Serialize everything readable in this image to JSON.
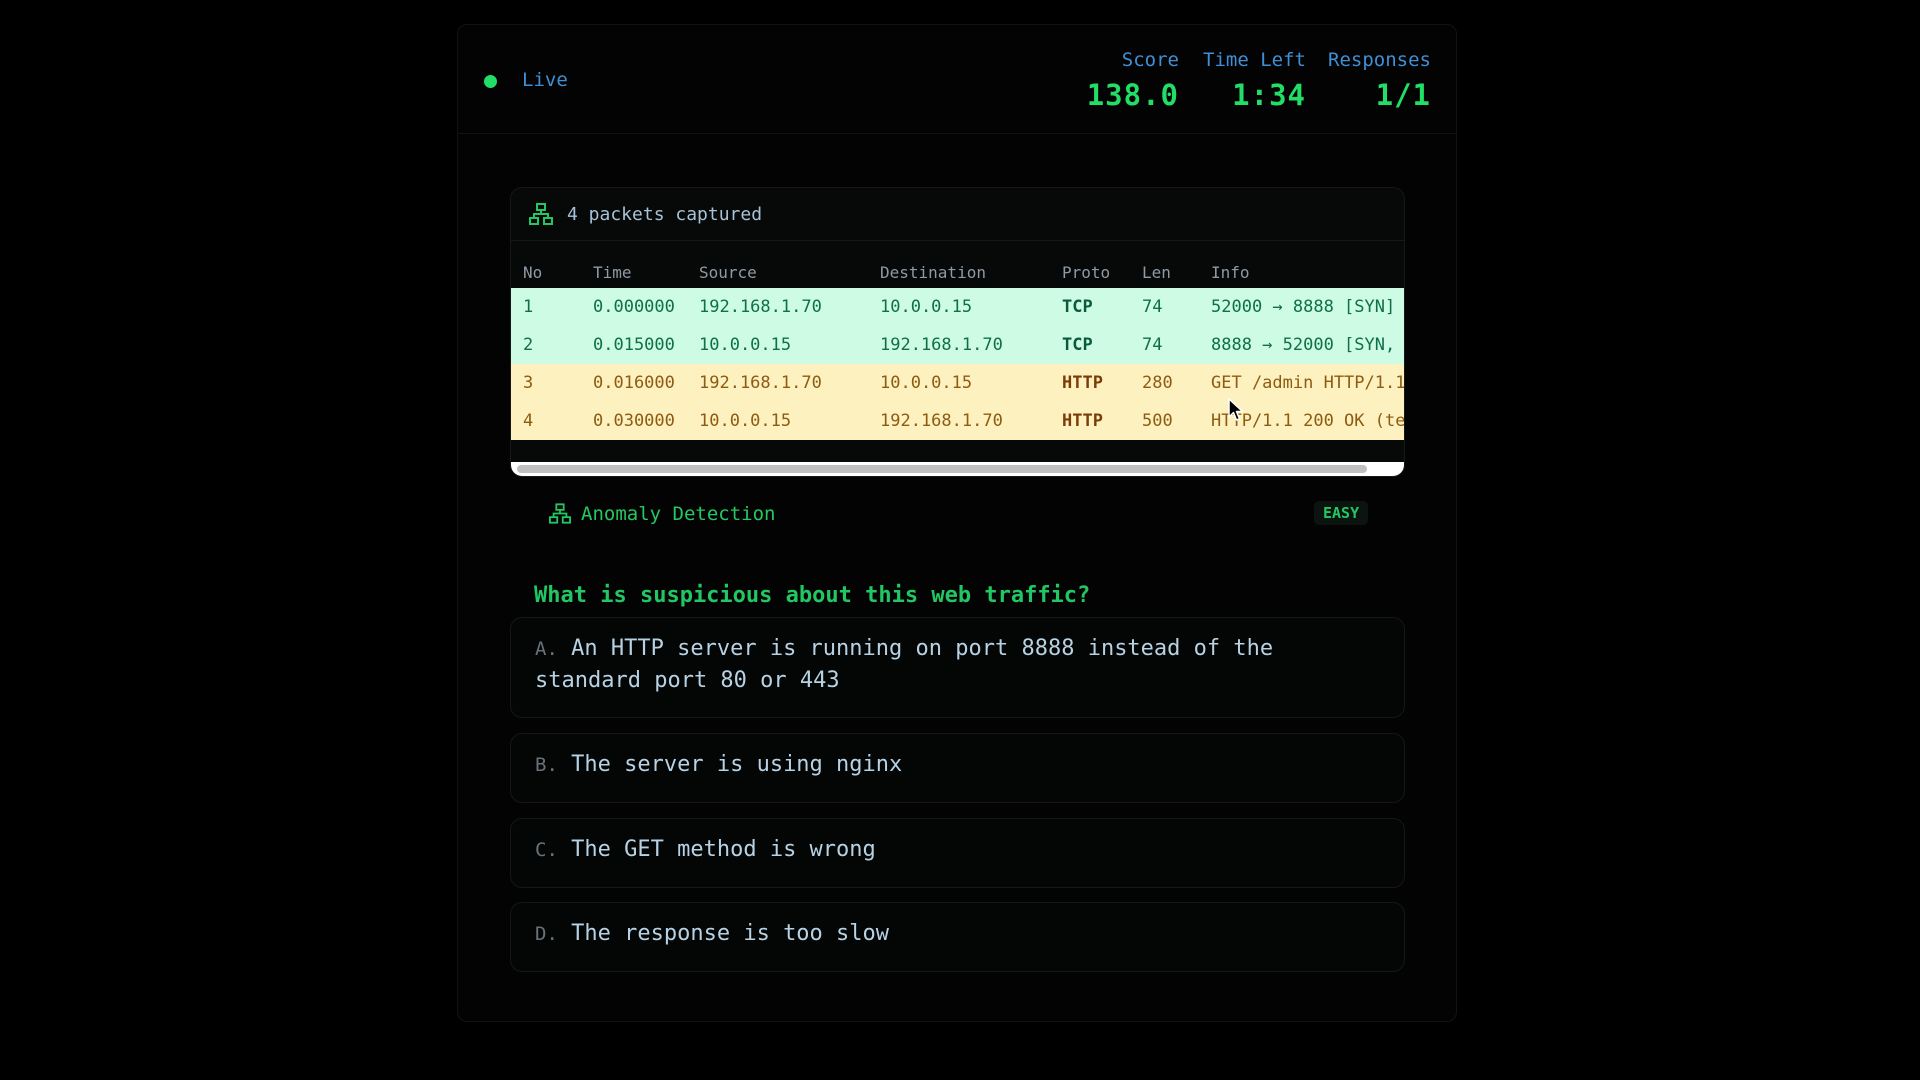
{
  "header": {
    "live_label": "Live",
    "score_label": "Score",
    "score_value": "138.0",
    "time_label": "Time Left",
    "time_value": "1:34",
    "responses_label": "Responses",
    "responses_value": "1/1"
  },
  "capture": {
    "icon": "network-icon",
    "count_label": "4 packets captured",
    "columns": [
      "No",
      "Time",
      "Source",
      "Destination",
      "Proto",
      "Len",
      "Info"
    ],
    "rows": [
      {
        "no": "1",
        "time": "0.000000",
        "source": "192.168.1.70",
        "destination": "10.0.0.15",
        "proto": "TCP",
        "len": "74",
        "info": "52000 → 8888 [SYN]"
      },
      {
        "no": "2",
        "time": "0.015000",
        "source": "10.0.0.15",
        "destination": "192.168.1.70",
        "proto": "TCP",
        "len": "74",
        "info": "8888 → 52000 [SYN,"
      },
      {
        "no": "3",
        "time": "0.016000",
        "source": "192.168.1.70",
        "destination": "10.0.0.15",
        "proto": "HTTP",
        "len": "280",
        "info": "GET /admin HTTP/1.1"
      },
      {
        "no": "4",
        "time": "0.030000",
        "source": "10.0.0.15",
        "destination": "192.168.1.70",
        "proto": "HTTP",
        "len": "500",
        "info": "HTTP/1.1 200 OK (te"
      }
    ]
  },
  "question": {
    "category_icon": "network-icon",
    "category": "Anomaly Detection",
    "difficulty": "EASY",
    "text": "What is suspicious about this web traffic?",
    "options": [
      {
        "letter": "A.",
        "text": "An HTTP server is running on port 8888 instead of the standard port 80 or 443"
      },
      {
        "letter": "B.",
        "text": "The server is using nginx"
      },
      {
        "letter": "C.",
        "text": "The GET method is wrong"
      },
      {
        "letter": "D.",
        "text": "The response is too slow"
      }
    ]
  },
  "colors": {
    "accent_green": "#22dd66",
    "label_blue": "#3f8fd6",
    "tcp_row": "#cdfbe3",
    "http_row": "#fdf1c0"
  }
}
